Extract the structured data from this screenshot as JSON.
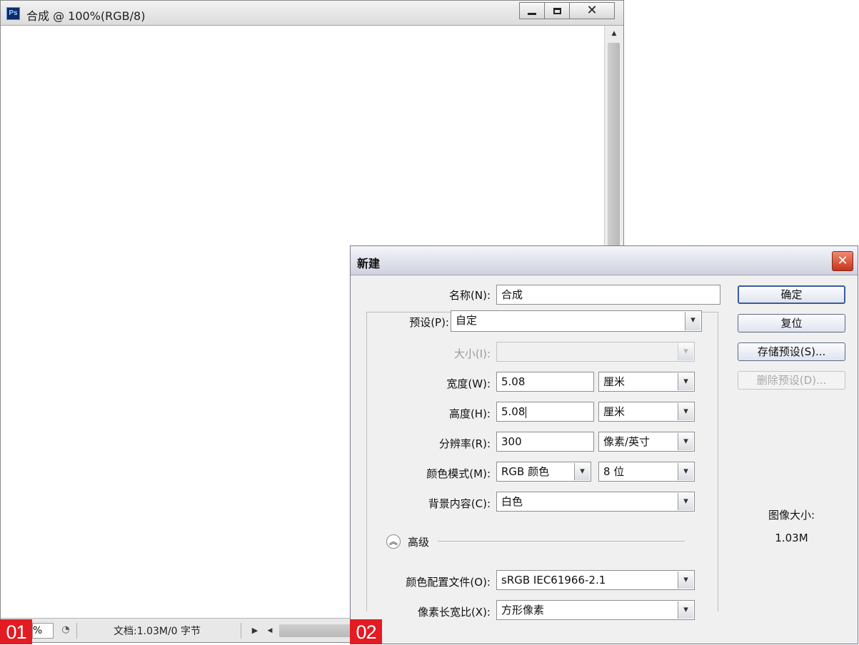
{
  "document_window": {
    "app_icon": "Ps",
    "title": "合成 @ 100%(RGB/8)",
    "buttons": {
      "minimize": "minimize-icon",
      "maximize": "maximize-icon",
      "close": "close-icon"
    },
    "status": {
      "zoom_value": "%",
      "document_info": "文档:1.03M/0 字节"
    }
  },
  "badges": [
    "01",
    "02"
  ],
  "dialog": {
    "title": "新建",
    "name": {
      "label": "名称(N):",
      "value": "合成"
    },
    "preset": {
      "label": "预设(P):",
      "value": "自定"
    },
    "size": {
      "label": "大小(I):",
      "value": ""
    },
    "width": {
      "label": "宽度(W):",
      "value": "5.08",
      "unit": "厘米"
    },
    "height": {
      "label": "高度(H):",
      "value": "5.08",
      "unit": "厘米"
    },
    "resolution": {
      "label": "分辨率(R):",
      "value": "300",
      "unit": "像素/英寸"
    },
    "color_mode": {
      "label": "颜色模式(M):",
      "value": "RGB 颜色",
      "depth": "8 位"
    },
    "background": {
      "label": "背景内容(C):",
      "value": "白色"
    },
    "advanced_label": "高级",
    "color_profile": {
      "label": "颜色配置文件(O):",
      "value": "sRGB IEC61966-2.1"
    },
    "pixel_aspect": {
      "label": "像素长宽比(X):",
      "value": "方形像素"
    },
    "buttons": {
      "ok": "确定",
      "reset": "复位",
      "save_preset": "存储预设(S)...",
      "delete_preset": "删除预设(D)..."
    },
    "image_size_label": "图像大小:",
    "image_size_value": "1.03M"
  }
}
